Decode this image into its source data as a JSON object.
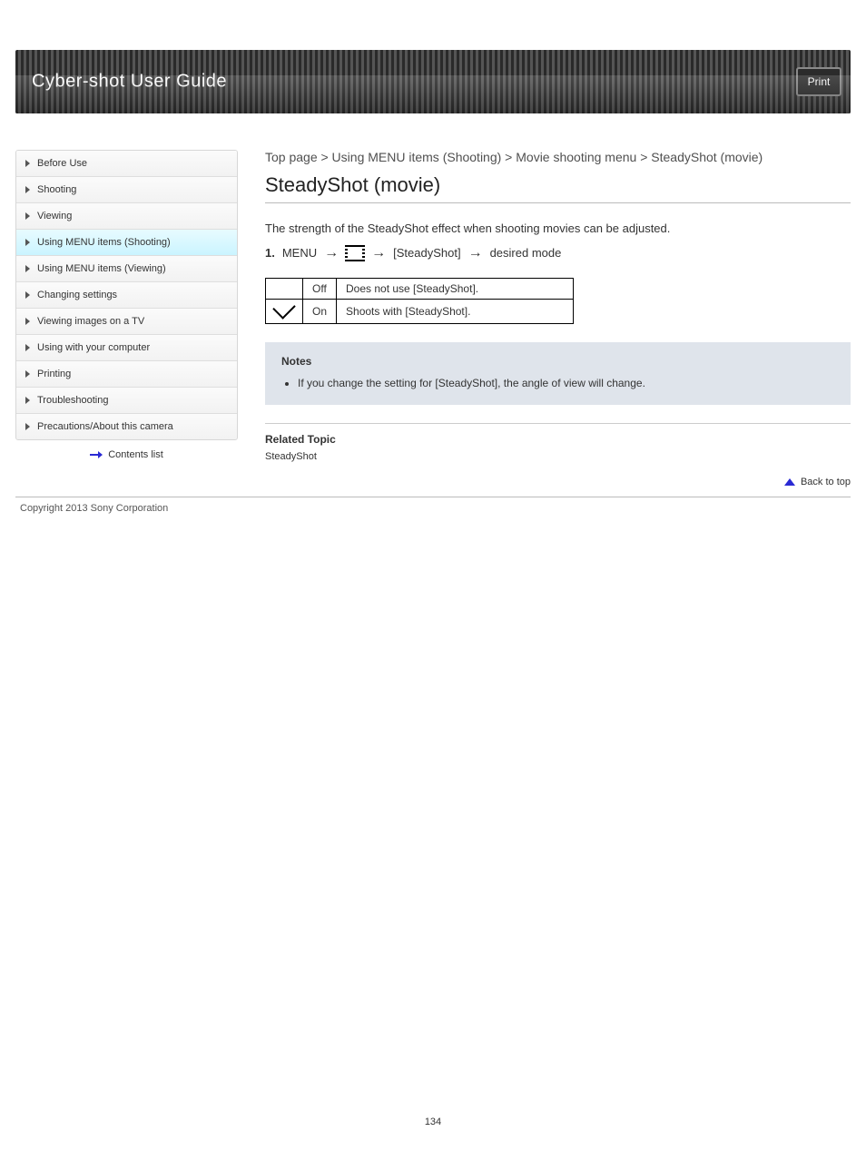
{
  "header": {
    "title": "Cyber-shot User Guide",
    "print_label": "Print"
  },
  "sidebar": {
    "items": [
      {
        "label": "Before Use"
      },
      {
        "label": "Shooting"
      },
      {
        "label": "Viewing"
      },
      {
        "label": "Using MENU items (Shooting)"
      },
      {
        "label": "Using MENU items (Viewing)"
      },
      {
        "label": "Changing settings"
      },
      {
        "label": "Viewing images on a TV"
      },
      {
        "label": "Using with your computer"
      },
      {
        "label": "Printing"
      },
      {
        "label": "Troubleshooting"
      },
      {
        "label": "Precautions/About this camera"
      }
    ],
    "selected_index": 3,
    "top_link": "Contents list"
  },
  "content": {
    "breadcrumb": "Top page > Using MENU items (Shooting) > Movie shooting menu > SteadyShot (movie)",
    "title": "SteadyShot (movie)",
    "description": "The strength of the SteadyShot effect when shooting movies can be adjusted.",
    "steps": [
      "MENU",
      "[SteadyShot]",
      "desired mode"
    ],
    "table": {
      "rows": [
        {
          "icon": "",
          "label": "Off",
          "desc": "Does not use [SteadyShot]."
        },
        {
          "icon": "check",
          "label": "On",
          "desc": "Shoots with [SteadyShot]."
        }
      ]
    },
    "note": {
      "title": "Notes",
      "items": [
        "If you change the setting for [SteadyShot], the angle of view will change."
      ]
    },
    "related": {
      "title": "Related Topic",
      "links": "SteadyShot"
    },
    "back_top": "Back to top"
  },
  "footer": {
    "copyright": "Copyright 2013 Sony Corporation",
    "page_number": "134"
  }
}
